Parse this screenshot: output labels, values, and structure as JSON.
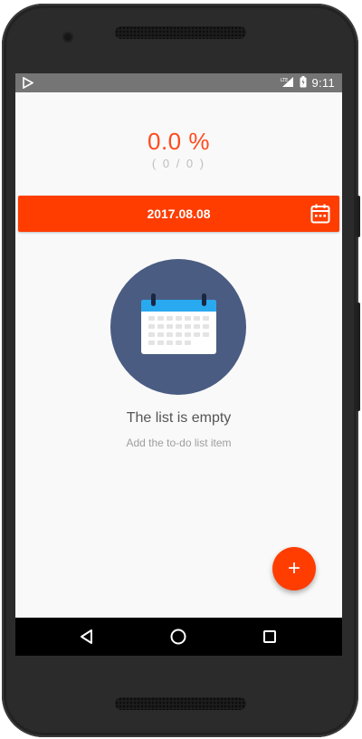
{
  "status_bar": {
    "time": "9:11",
    "network": "LTE",
    "icons": [
      "play-store-icon",
      "signal-icon",
      "battery-icon"
    ]
  },
  "progress": {
    "percent_text": "0.0 %",
    "count_text": "( 0 / 0 )"
  },
  "date_bar": {
    "date": "2017.08.08",
    "icon": "calendar-icon"
  },
  "empty_state": {
    "title": "The list is empty",
    "subtitle": "Add the to-do list item",
    "icon": "calendar-icon"
  },
  "fab": {
    "label": "+"
  },
  "nav_bar": {
    "buttons": [
      "back-icon",
      "home-icon",
      "recents-icon"
    ]
  },
  "colors": {
    "accent": "#ff3d00",
    "percent_text": "#ff4a1c",
    "circle": "#4a5c82",
    "status_bar": "#757575",
    "nav_bar": "#000000",
    "background": "#f9f9f9"
  }
}
